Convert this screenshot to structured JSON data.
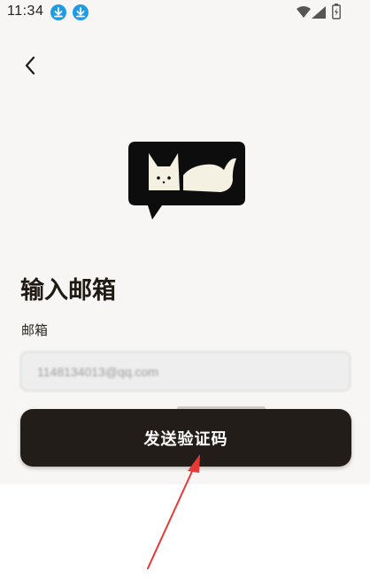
{
  "status_bar": {
    "time": "11:34",
    "icons": [
      "download-icon",
      "download-icon",
      "wifi-icon",
      "signal-icon",
      "battery-icon"
    ]
  },
  "nav": {
    "back_icon": "chevron-left-icon"
  },
  "logo": {
    "icon": "cat-fox-logo-icon"
  },
  "form": {
    "title": "输入邮箱",
    "email_label": "邮箱",
    "email_value": "1148134013@qq.com",
    "submit_label": "发送验证码"
  },
  "colors": {
    "background": "#f7f6f4",
    "button": "#221d18",
    "input_bg": "#eeeeee",
    "accent_download": "#1e9be6",
    "annotation": "#e53935"
  }
}
